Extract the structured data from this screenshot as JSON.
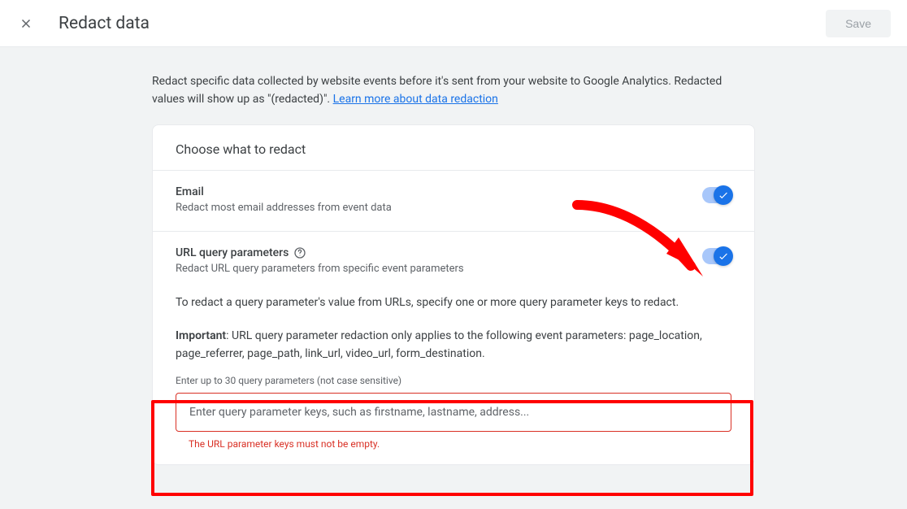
{
  "header": {
    "title": "Redact data",
    "save_label": "Save"
  },
  "intro": {
    "text_before_link": "Redact specific data collected by website events before it's sent from your website to Google Analytics. Redacted values will show up as \"(redacted)\". ",
    "link_text": "Learn more about data redaction"
  },
  "card": {
    "section_title": "Choose what to redact",
    "options": {
      "email": {
        "title": "Email",
        "subtitle": "Redact most email addresses from event data"
      },
      "url": {
        "title": "URL query parameters",
        "subtitle": "Redact URL query parameters from specific event parameters",
        "body1": "To redact a query parameter's value from URLs, specify one or more query parameter keys to redact.",
        "body2_label": "Important",
        "body2_text": ": URL query parameter redaction only applies to the following event parameters: page_location, page_referrer, page_path, link_url, video_url, form_destination.",
        "input_hint": "Enter up to 30 query parameters (not case sensitive)",
        "input_placeholder": "Enter query parameter keys, such as firstname, lastname, address...",
        "error": "The URL parameter keys must not be empty."
      }
    }
  }
}
